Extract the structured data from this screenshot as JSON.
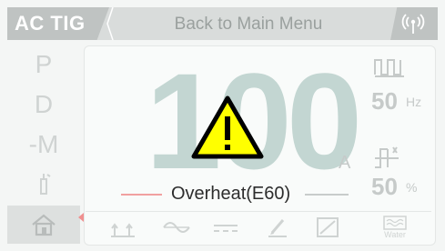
{
  "header": {
    "mode": "AC TIG",
    "back_label": "Back to Main Menu",
    "wifi_icon": "wifi-icon"
  },
  "sidebar": {
    "items": [
      {
        "label": "P"
      },
      {
        "label": "D"
      },
      {
        "label": "-M"
      },
      {
        "label": "",
        "icon": "torch-icon"
      },
      {
        "label": "",
        "icon": "home-icon"
      }
    ]
  },
  "main": {
    "current_value": "100",
    "current_unit": "A",
    "frequency_value": "50",
    "frequency_unit": "Hz",
    "balance_value": "50",
    "balance_unit": "%"
  },
  "alarm": {
    "message": "Overheat(E60)",
    "icon": "warning-icon"
  },
  "toolbar": {
    "items": [
      "2t-4t-icon",
      "ac-wave-icon",
      "dc-icon",
      "pen-icon",
      "square-icon",
      "water-icon"
    ],
    "water_label": "Water"
  },
  "colors": {
    "background": "#f4f6f5",
    "header": "#d9dcdb",
    "big_value": "#c3d6d2",
    "warning_fill": "#ffff00",
    "alarm_text": "#2d2d2d"
  }
}
